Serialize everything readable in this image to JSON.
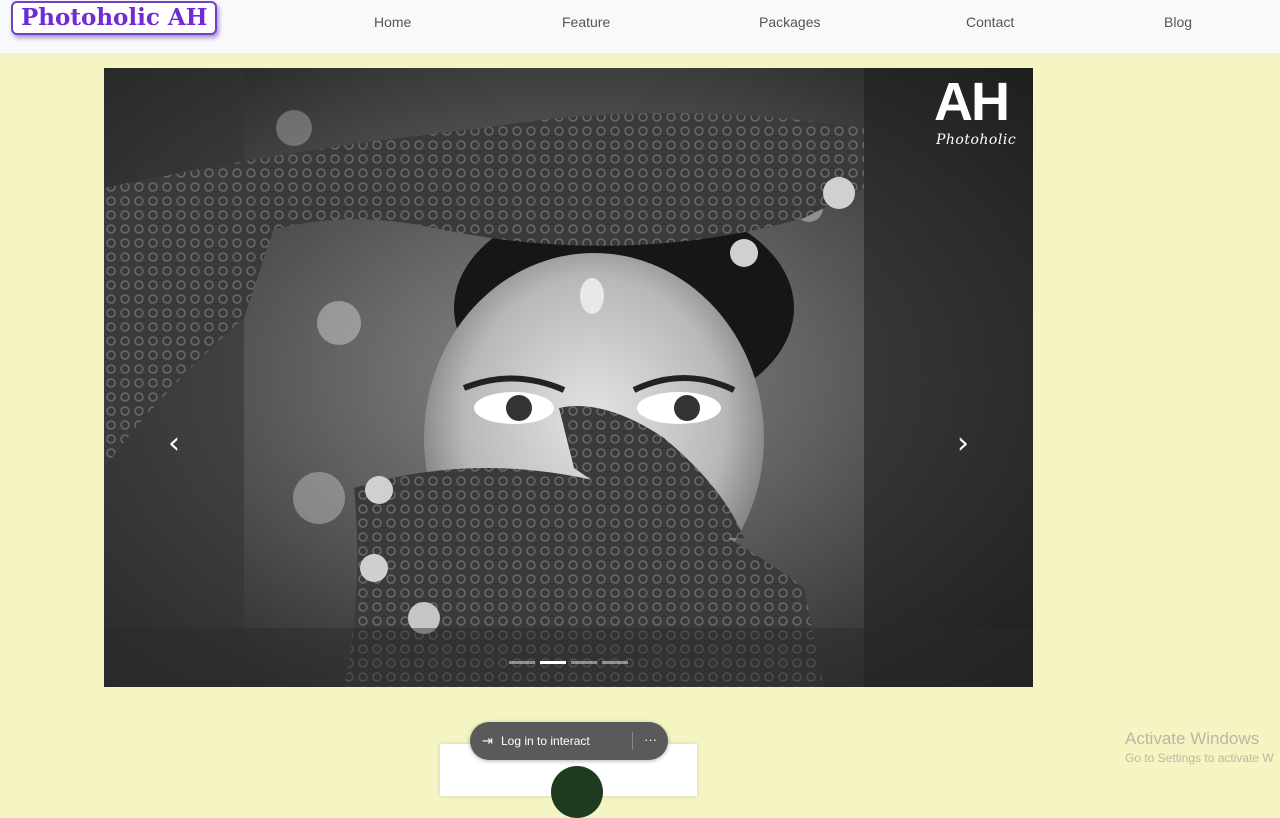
{
  "navbar": {
    "brand": "Photoholic AH",
    "links": [
      "Home",
      "Feature",
      "Packages",
      "Contact",
      "Blog"
    ]
  },
  "carousel": {
    "prev_icon": "chevron-left-icon",
    "next_icon": "chevron-right-icon",
    "prev_glyph": "‹",
    "next_glyph": "›",
    "slide_count": 4,
    "active_slide": 2,
    "watermark": {
      "letters": "AH",
      "script": "Photoholic"
    }
  },
  "login_overlay": {
    "icon": "login-arrow-icon",
    "icon_glyph": "⇥",
    "label": "Log in to interact",
    "more": "···"
  },
  "windows_notice": {
    "title": "Activate Windows",
    "subtitle": "Go to Settings to activate W"
  },
  "colors": {
    "page_background": "#f5f4c3",
    "navbar_background": "#f8f9fa",
    "brand_purple": "#6f2bd6"
  }
}
